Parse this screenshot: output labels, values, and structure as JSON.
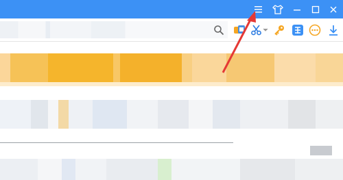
{
  "colors": {
    "titlebar": "#3c91f5",
    "banner": "#f5b52c",
    "annotation_arrow": "#e53935"
  },
  "titlebar": {
    "buttons": [
      {
        "icon": "menu-icon"
      },
      {
        "icon": "skin-icon"
      },
      {
        "icon": "minimize-icon"
      },
      {
        "icon": "maximize-icon"
      },
      {
        "icon": "close-icon"
      }
    ]
  },
  "toolbar": {
    "icons": [
      "search-icon",
      "translate-icon",
      "scissors-icon",
      "key-icon",
      "dictionary-icon",
      "more-icon",
      "download-icon"
    ]
  }
}
